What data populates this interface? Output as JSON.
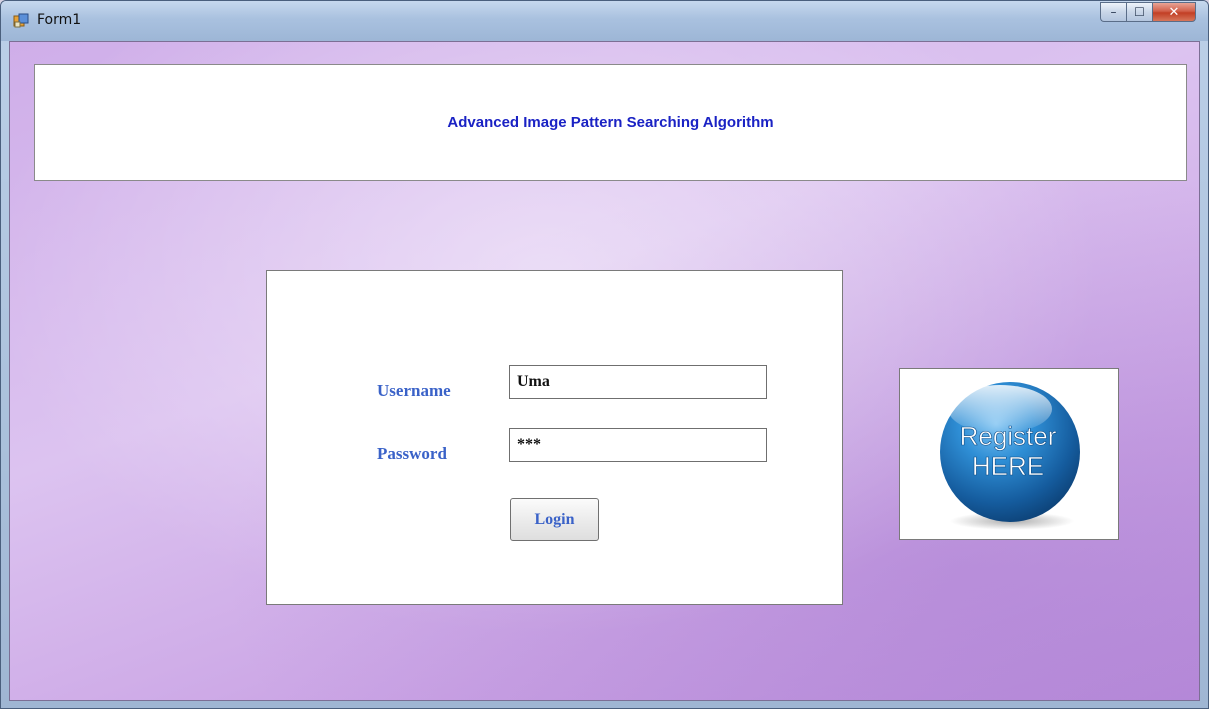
{
  "window": {
    "title": "Form1",
    "caption_buttons": {
      "minimize_glyph": "–",
      "maximize_glyph": "☐",
      "close_glyph": "✕"
    }
  },
  "header": {
    "title": "Advanced Image Pattern Searching Algorithm"
  },
  "login": {
    "username_label": "Username",
    "username_value": "Uma",
    "password_label": "Password",
    "password_value": "***",
    "login_button_label": "Login"
  },
  "register": {
    "line1": "Register",
    "line2": "HERE"
  },
  "colors": {
    "header_title": "#1a22c4",
    "label_text": "#3a62c8",
    "background_purple": "#cfaee9",
    "register_blue": "#1f6fb4"
  },
  "icons": {
    "app": "form-app-icon",
    "register": "register-here-button-graphic"
  }
}
